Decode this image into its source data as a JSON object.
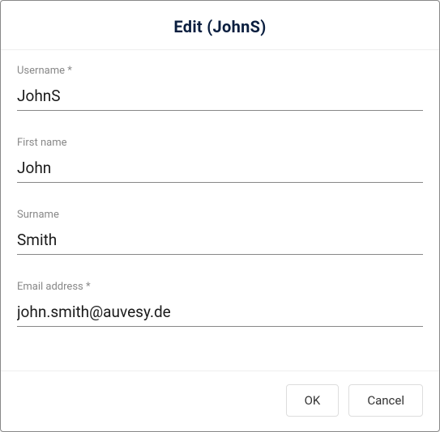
{
  "dialog": {
    "title": "Edit (JohnS)"
  },
  "fields": {
    "username": {
      "label": "Username *",
      "value": "JohnS"
    },
    "firstname": {
      "label": "First name",
      "value": "John"
    },
    "surname": {
      "label": "Surname",
      "value": "Smith"
    },
    "email": {
      "label": "Email address *",
      "value": "john.smith@auvesy.de"
    }
  },
  "buttons": {
    "ok": "OK",
    "cancel": "Cancel"
  }
}
